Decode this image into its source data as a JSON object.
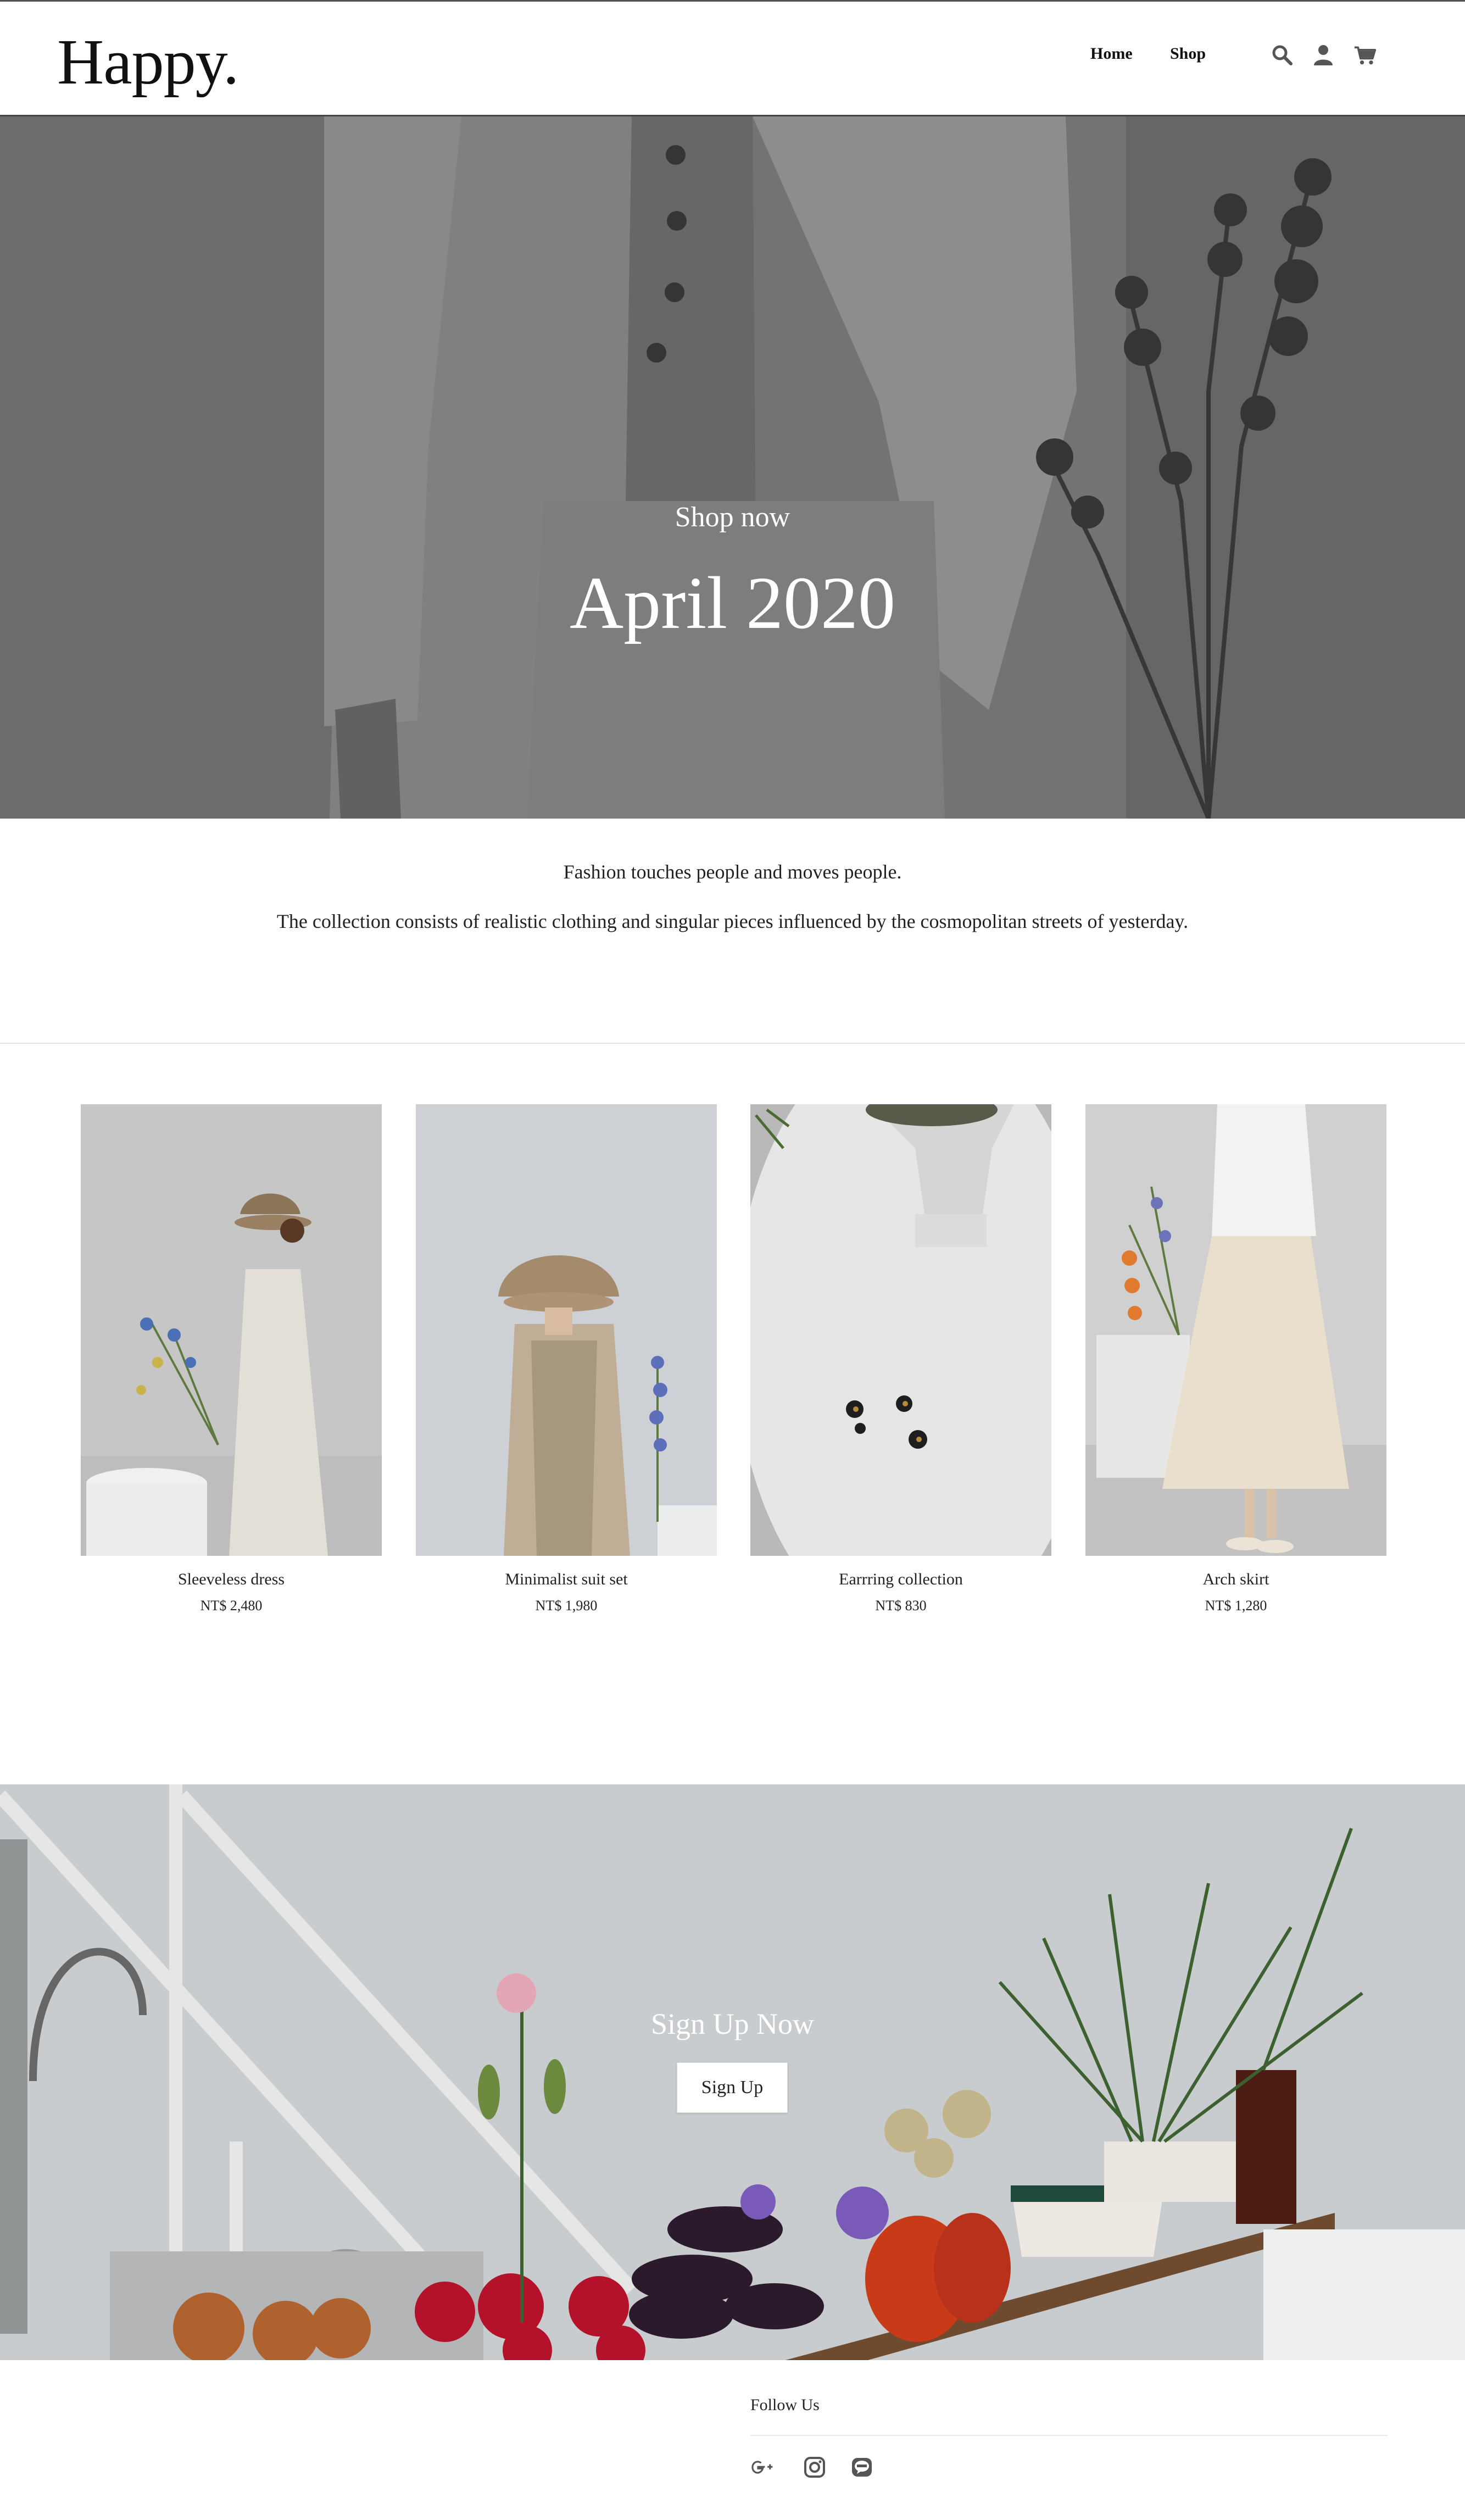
{
  "header": {
    "logo": "Happy.",
    "nav": [
      {
        "label": "Home"
      },
      {
        "label": "Shop"
      }
    ],
    "icons": [
      "search-icon",
      "account-icon",
      "cart-icon"
    ]
  },
  "hero": {
    "subtitle": "Shop now",
    "title": "April 2020"
  },
  "intro": {
    "line1": "Fashion touches people and moves people.",
    "line2": "The collection consists of realistic clothing and singular pieces influenced by the cosmopolitan streets of yesterday."
  },
  "products": [
    {
      "name": "Sleeveless dress",
      "price": "NT$ 2,480"
    },
    {
      "name": "Minimalist suit set",
      "price": "NT$ 1,980"
    },
    {
      "name": "Earrring collection",
      "price": "NT$ 830"
    },
    {
      "name": "Arch skirt",
      "price": "NT$ 1,280"
    }
  ],
  "signup": {
    "title": "Sign Up Now",
    "button": "Sign Up"
  },
  "footer": {
    "follow_label": "Follow Us",
    "social": [
      "google-plus-icon",
      "instagram-icon",
      "line-icon"
    ]
  },
  "colors": {
    "text": "#222222",
    "hero_bg": "#7c7c7c",
    "banner_bg": "#c9cdcf",
    "divider": "#e3e3e3"
  }
}
